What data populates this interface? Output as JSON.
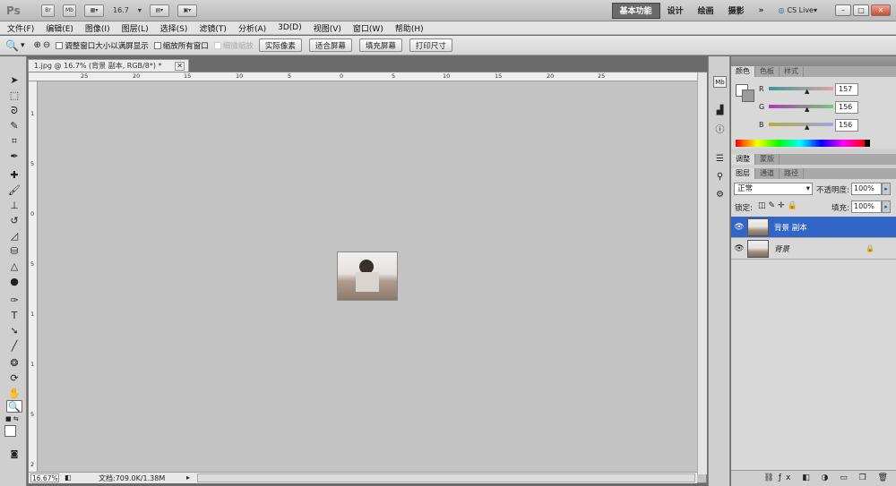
{
  "appbar": {
    "logo": "Ps",
    "btn_bridge": "Br",
    "btn_minibridge": "Mb",
    "zoom_value": "16.7",
    "workspaces": [
      "基本功能",
      "设计",
      "绘画",
      "摄影"
    ],
    "more": "»",
    "cslive": "CS Live",
    "win_min": "–",
    "win_max": "□",
    "win_close": "✕"
  },
  "menubar": {
    "items": [
      "文件(F)",
      "编辑(E)",
      "图像(I)",
      "图层(L)",
      "选择(S)",
      "滤镜(T)",
      "分析(A)",
      "3D(D)",
      "视图(V)",
      "窗口(W)",
      "帮助(H)"
    ]
  },
  "options": {
    "resize_windows": "调整窗口大小以满屏显示",
    "zoom_all": "缩放所有窗口",
    "scrubby": "细微缩放",
    "actual_pixels": "实际像素",
    "fit_screen": "适合屏幕",
    "fill_screen": "填充屏幕",
    "print_size": "打印尺寸"
  },
  "document": {
    "tab_title": "1.jpg @ 16.7% (背景 副本, RGB/8*) *",
    "h_ruler": [
      "25",
      "20",
      "15",
      "10",
      "5",
      "0",
      "5",
      "10",
      "15",
      "20",
      "25"
    ],
    "v_ruler": [
      "1",
      "5",
      "0",
      "5",
      "1",
      "1",
      "5",
      "2"
    ],
    "zoom": "16.67%",
    "doc_info": "文档:709.0K/1.38M"
  },
  "color_panel": {
    "tabs": [
      "颜色",
      "色板",
      "样式"
    ],
    "labels": [
      "R",
      "G",
      "B"
    ],
    "values": [
      "157",
      "156",
      "156"
    ],
    "colors": {
      "r_track": "#e0a3a3",
      "g_track": "#79c879",
      "b_track": "#a3a3e0"
    }
  },
  "adjust_panel": {
    "tabs": [
      "调整",
      "蒙版"
    ]
  },
  "layers_panel": {
    "tabs": [
      "图层",
      "通道",
      "路径"
    ],
    "blend_mode": "正常",
    "opacity_label": "不透明度:",
    "opacity": "100%",
    "lock_label": "锁定:",
    "fill_label": "填充:",
    "fill": "100%",
    "layers": [
      {
        "name": "背景 副本",
        "selected": true
      },
      {
        "name": "背景",
        "selected": false
      }
    ]
  }
}
